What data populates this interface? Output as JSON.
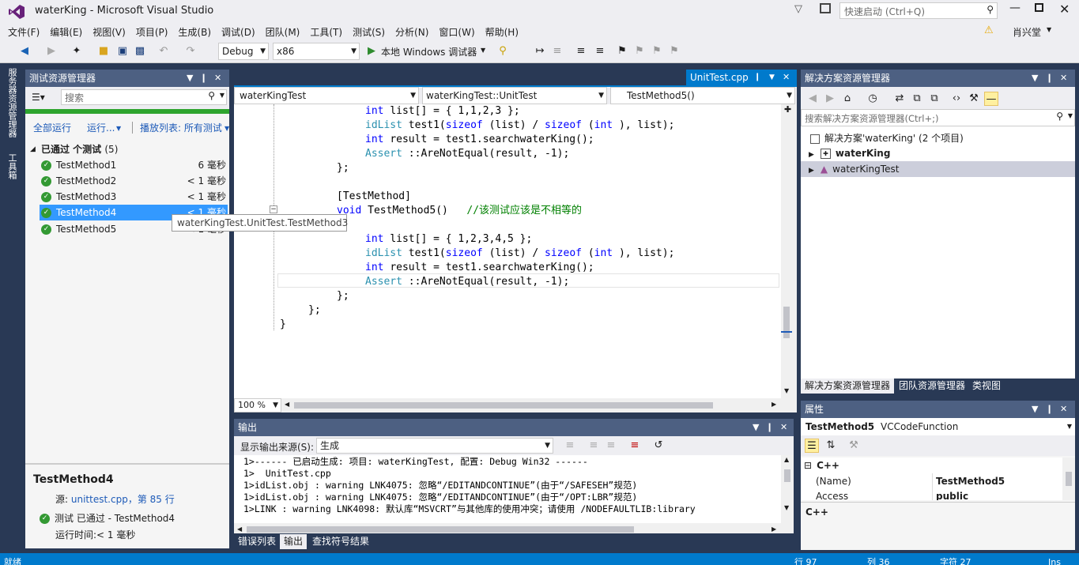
{
  "window": {
    "title": "waterKing - Microsoft Visual Studio",
    "quick_launch_placeholder": "快速启动 (Ctrl+Q)",
    "user": "肖兴堂"
  },
  "menu": [
    "文件(F)",
    "编辑(E)",
    "视图(V)",
    "项目(P)",
    "生成(B)",
    "调试(D)",
    "团队(M)",
    "工具(T)",
    "测试(S)",
    "分析(N)",
    "窗口(W)",
    "帮助(H)"
  ],
  "toolbar": {
    "config": "Debug",
    "platform": "x86",
    "run_label": "本地 Windows 调试器"
  },
  "side_tabs": [
    "服务器资源管理器",
    "工具箱"
  ],
  "test_explorer": {
    "title": "测试资源管理器",
    "search_placeholder": "搜索",
    "run_all": "全部运行",
    "run": "运行...",
    "playlist": "播放列表: 所有测试",
    "group": {
      "label": "已通过 个测试",
      "count": "(5)"
    },
    "tests": [
      {
        "name": "TestMethod1",
        "time": "6 毫秒"
      },
      {
        "name": "TestMethod2",
        "time": "< 1 毫秒"
      },
      {
        "name": "TestMethod3",
        "time": "< 1 毫秒"
      },
      {
        "name": "TestMethod4",
        "time": "< 1 毫秒"
      },
      {
        "name": "TestMethod5",
        "time": "< 1 毫秒"
      }
    ],
    "tooltip": "waterKingTest.UnitTest.TestMethod3",
    "detail": {
      "title": "TestMethod4",
      "source_label": "源:",
      "source_link": "unittest.cpp，第 85 行",
      "status": "测试 已通过 - TestMethod4",
      "runtime": "运行时间:< 1 毫秒"
    }
  },
  "editor": {
    "tab": "UnitTest.cpp",
    "nav": [
      "waterKingTest",
      "waterKingTest::UnitTest",
      "TestMethod5()"
    ],
    "zoom": "100 %",
    "lines": [
      {
        "indent": 4,
        "parts": [
          [
            "kw",
            "int"
          ],
          [
            "",
            "list[] = { 1,1,2,3 };"
          ]
        ]
      },
      {
        "indent": 4,
        "parts": [
          [
            "ty",
            "idList"
          ],
          [
            "",
            "test1("
          ],
          [
            "kw",
            "sizeof"
          ],
          [
            "",
            "(list) / "
          ],
          [
            "kw",
            "sizeof"
          ],
          [
            "",
            "("
          ],
          [
            "kw",
            "int"
          ],
          [
            "",
            "), list);"
          ]
        ]
      },
      {
        "indent": 4,
        "parts": [
          [
            "kw",
            "int"
          ],
          [
            "",
            "result = test1.searchwaterKing();"
          ]
        ]
      },
      {
        "indent": 4,
        "parts": [
          [
            "ty",
            "Assert"
          ],
          [
            "",
            "::AreNotEqual(result, -1);"
          ]
        ]
      },
      {
        "indent": 3,
        "parts": [
          [
            "",
            "};"
          ]
        ]
      },
      {
        "indent": 3,
        "parts": [
          [
            "",
            ""
          ]
        ]
      },
      {
        "indent": 3,
        "parts": [
          [
            "",
            "[TestMethod]"
          ]
        ]
      },
      {
        "indent": 3,
        "parts": [
          [
            "kw",
            "void"
          ],
          [
            "",
            "TestMethod5()   "
          ],
          [
            "cm",
            "//该测试应该是不相等的"
          ]
        ]
      },
      {
        "indent": 3,
        "parts": [
          [
            "",
            ""
          ]
        ]
      },
      {
        "indent": 4,
        "parts": [
          [
            "kw",
            "int"
          ],
          [
            "",
            "list[] = { 1,2,3,4,5 };"
          ]
        ]
      },
      {
        "indent": 4,
        "parts": [
          [
            "ty",
            "idList"
          ],
          [
            "",
            "test1("
          ],
          [
            "kw",
            "sizeof"
          ],
          [
            "",
            "(list) / "
          ],
          [
            "kw",
            "sizeof"
          ],
          [
            "",
            "("
          ],
          [
            "kw",
            "int"
          ],
          [
            "",
            "), list);"
          ]
        ]
      },
      {
        "indent": 4,
        "parts": [
          [
            "kw",
            "int"
          ],
          [
            "",
            "result = test1.searchwaterKing();"
          ]
        ]
      },
      {
        "indent": 4,
        "parts": [
          [
            "ty",
            "Assert"
          ],
          [
            "",
            "::AreNotEqual(result, -1);"
          ]
        ]
      },
      {
        "indent": 3,
        "parts": [
          [
            "",
            "};"
          ]
        ]
      },
      {
        "indent": 2,
        "parts": [
          [
            "",
            "};"
          ]
        ]
      },
      {
        "indent": 1,
        "parts": [
          [
            "",
            "}"
          ]
        ]
      }
    ]
  },
  "output": {
    "title": "输出",
    "source_label": "显示输出来源(S):",
    "source_value": "生成",
    "lines": [
      "1>------ 已启动生成: 项目: waterKingTest, 配置: Debug Win32 ------",
      "1>  UnitTest.cpp",
      "1>idList.obj : warning LNK4075: 忽略“/EDITANDCONTINUE”(由于“/SAFESEH”规范)",
      "1>idList.obj : warning LNK4075: 忽略“/EDITANDCONTINUE”(由于“/OPT:LBR”规范)",
      "1>LINK : warning LNK4098: 默认库“MSVCRT”与其他库的使用冲突；请使用 /NODEFAULTLIB:library"
    ],
    "tabs": [
      "错误列表",
      "输出",
      "查找符号结果"
    ]
  },
  "solution_explorer": {
    "title": "解决方案资源管理器",
    "search_placeholder": "搜索解决方案资源管理器(Ctrl+;)",
    "solution": "解决方案'waterKing' (2 个项目)",
    "projects": [
      "waterKing",
      "waterKingTest"
    ],
    "tabs": [
      "解决方案资源管理器",
      "团队资源管理器",
      "类视图"
    ]
  },
  "properties": {
    "title": "属性",
    "object": "TestMethod5",
    "object_type": "VCCodeFunction",
    "category": "C++",
    "rows": [
      {
        "name": "(Name)",
        "value": "TestMethod5"
      },
      {
        "name": "Access",
        "value": "public"
      }
    ],
    "description": "C++"
  },
  "statusbar": {
    "ready": "就绪",
    "line": "行 97",
    "col": "列 36",
    "char": "字符 27",
    "mode": "Ins"
  }
}
